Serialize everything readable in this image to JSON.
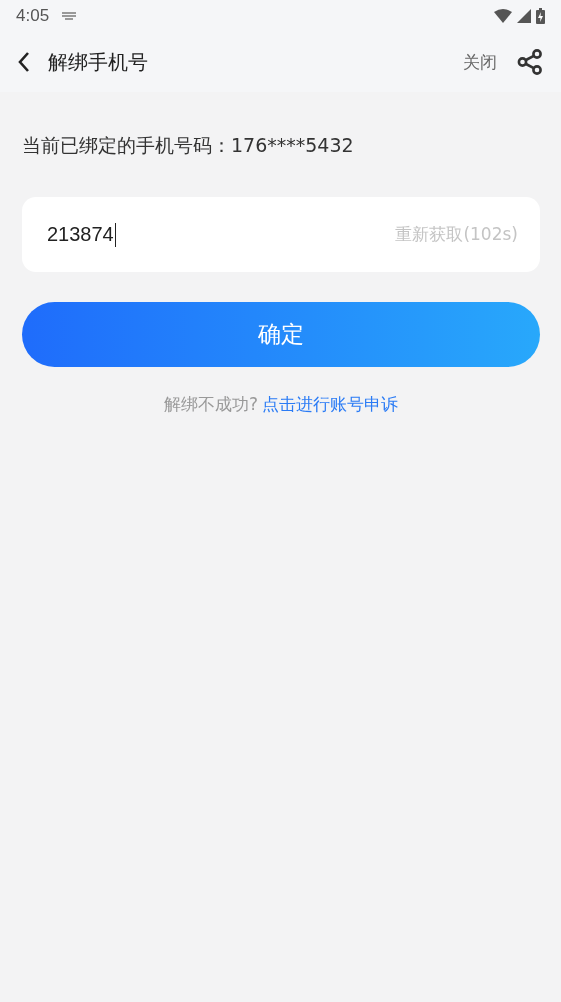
{
  "status_bar": {
    "time": "4:05"
  },
  "header": {
    "title": "解绑手机号",
    "close": "关闭"
  },
  "bound_phone": "当前已绑定的手机号码：176****5432",
  "code_field": {
    "value": "213874",
    "resend": {
      "label": "重新获取(102s)",
      "disabled": true
    }
  },
  "confirm_button": "确定",
  "help": {
    "text": "解绑不成功?",
    "link": "点击进行账号申诉"
  }
}
